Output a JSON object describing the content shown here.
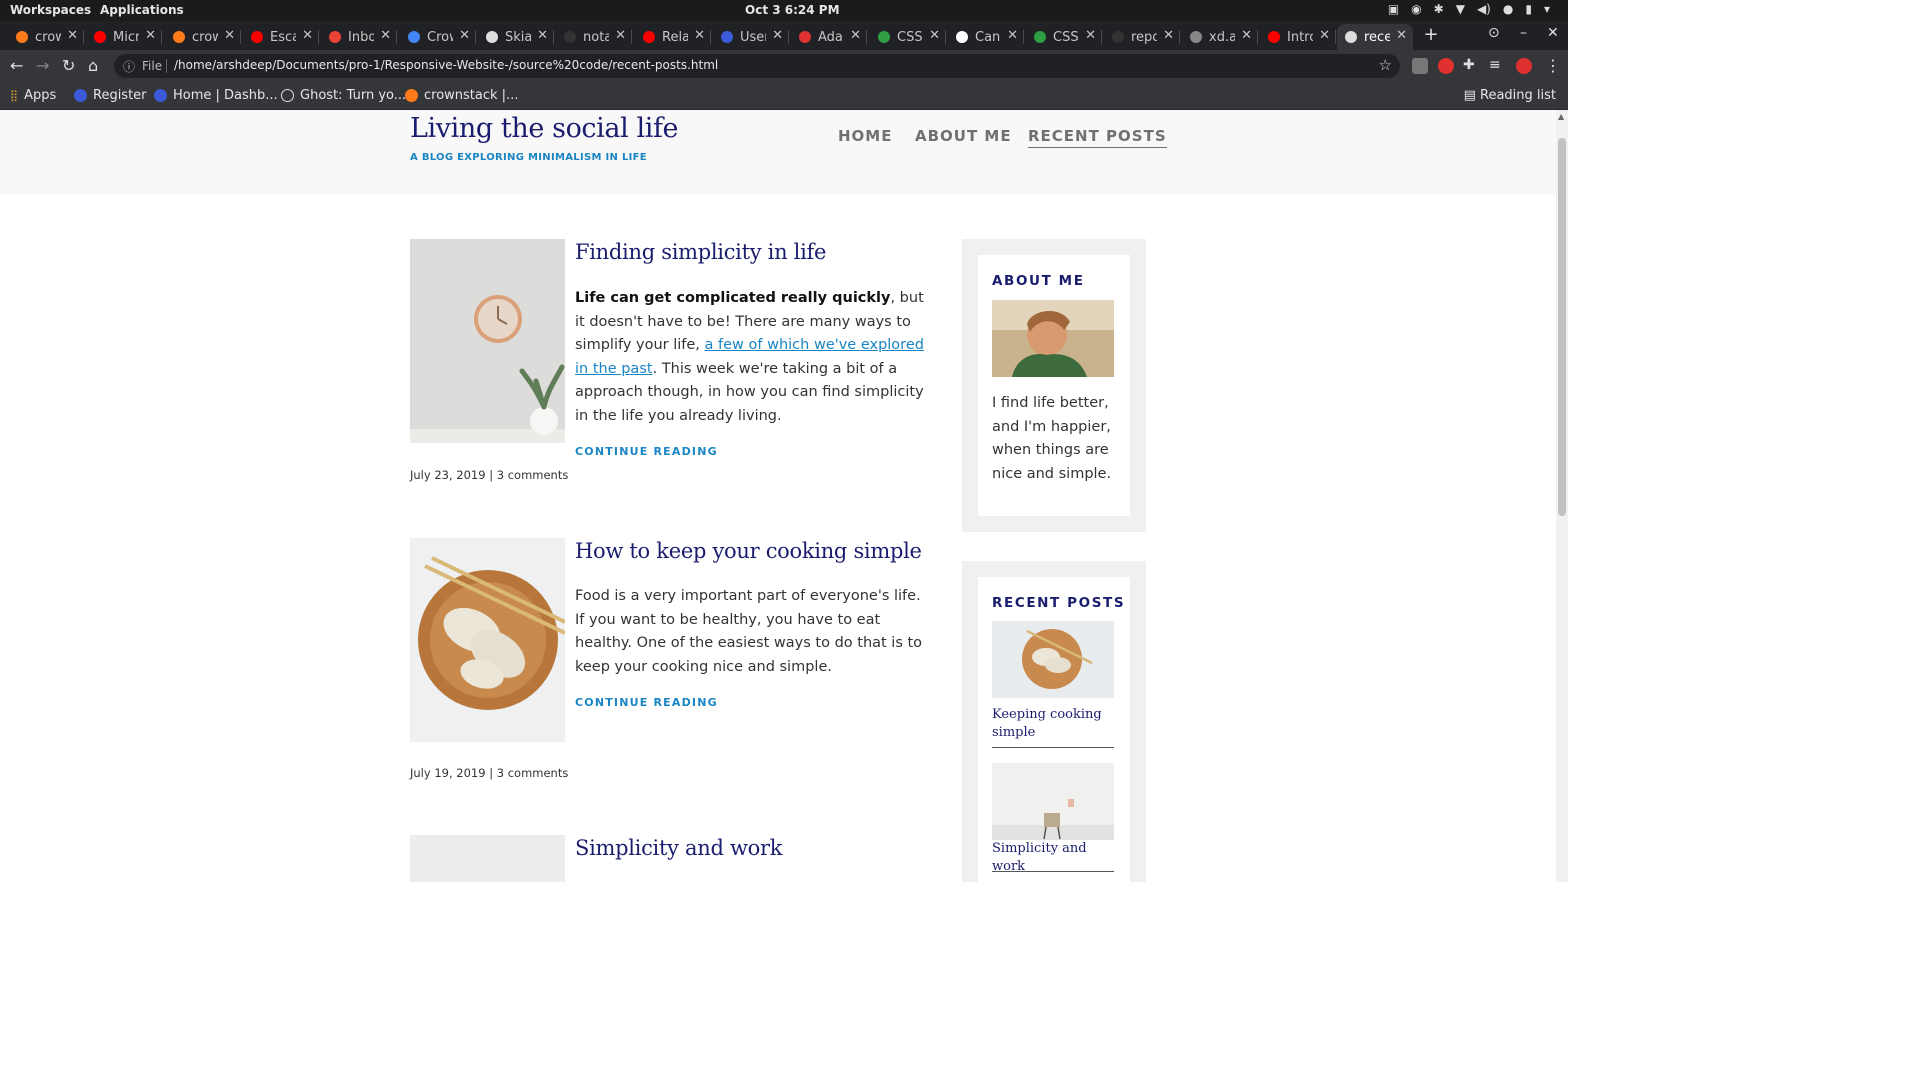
{
  "os": {
    "workspaces": "Workspaces",
    "applications": "Applications",
    "clock": "Oct 3   6:24 PM"
  },
  "tabs": [
    {
      "label": "crow",
      "color": "#ff7a18"
    },
    {
      "label": "Micr",
      "color": "#ff0000"
    },
    {
      "label": "crow",
      "color": "#ff7a18"
    },
    {
      "label": "Esca",
      "color": "#ff0000"
    },
    {
      "label": "Inbo",
      "color": "#ea4335"
    },
    {
      "label": "Crow",
      "color": "#4285f4"
    },
    {
      "label": "Skia",
      "color": "#dddddd"
    },
    {
      "label": "nota",
      "color": "#333333"
    },
    {
      "label": "Rela",
      "color": "#ff0000"
    },
    {
      "label": "User",
      "color": "#3b5bdb"
    },
    {
      "label": "Adap",
      "color": "#e03131"
    },
    {
      "label": "CSS",
      "color": "#2f9e44"
    },
    {
      "label": "Can",
      "color": "#ffffff"
    },
    {
      "label": "CSS",
      "color": "#2f9e44"
    },
    {
      "label": "repo",
      "color": "#333333"
    },
    {
      "label": "xd.a",
      "color": "#888888"
    },
    {
      "label": "Intro",
      "color": "#ff0000"
    },
    {
      "label": "rece",
      "color": "#dddddd",
      "active": true
    }
  ],
  "toolbar": {
    "file_label": "File",
    "url": "/home/arshdeep/Documents/pro-1/Responsive-Website-/source%20code/recent-posts.html"
  },
  "bookmarks": {
    "apps": "Apps",
    "items": [
      "Register",
      "Home | Dashb...",
      "Ghost: Turn yo...",
      "crownstack |..."
    ],
    "reading_list": "Reading list"
  },
  "site": {
    "title": "Living the social life",
    "tagline": "A BLOG EXPLORING MINIMALISM IN LIFE",
    "nav": [
      "HOME",
      "ABOUT ME",
      "RECENT POSTS"
    ]
  },
  "posts": [
    {
      "title": "Finding simplicity in life",
      "bold_lead": "Life can get complicated really quickly",
      "text_before_link": ", but it doesn't have to be! There are many ways to simplify your life, ",
      "link_text": "a few of which we've explored in the past",
      "text_after_link": ". This week we're taking a bit of a approach though, in how you can find simplicity in the life you already living.",
      "continue": "CONTINUE READING",
      "meta": "July 23, 2019 | 3 comments"
    },
    {
      "title": "How to keep your cooking simple",
      "body": "Food is a very important part of everyone's life. If you want to be healthy, you have to eat healthy. One of the easiest ways to do that is to keep your cooking nice and simple.",
      "continue": "CONTINUE READING",
      "meta": "July 19, 2019 | 3 comments"
    },
    {
      "title": "Simplicity and work"
    }
  ],
  "sidebar": {
    "about_title": "ABOUT ME",
    "about_text": "I find life better, and I'm happier, when things are nice and simple.",
    "recent_title": "RECENT POSTS",
    "recent": [
      "Keeping cooking simple",
      "Simplicity and work"
    ]
  },
  "colors": {
    "heading": "#1a1d6e",
    "accent": "#1a85c4",
    "nav": "#707070"
  }
}
